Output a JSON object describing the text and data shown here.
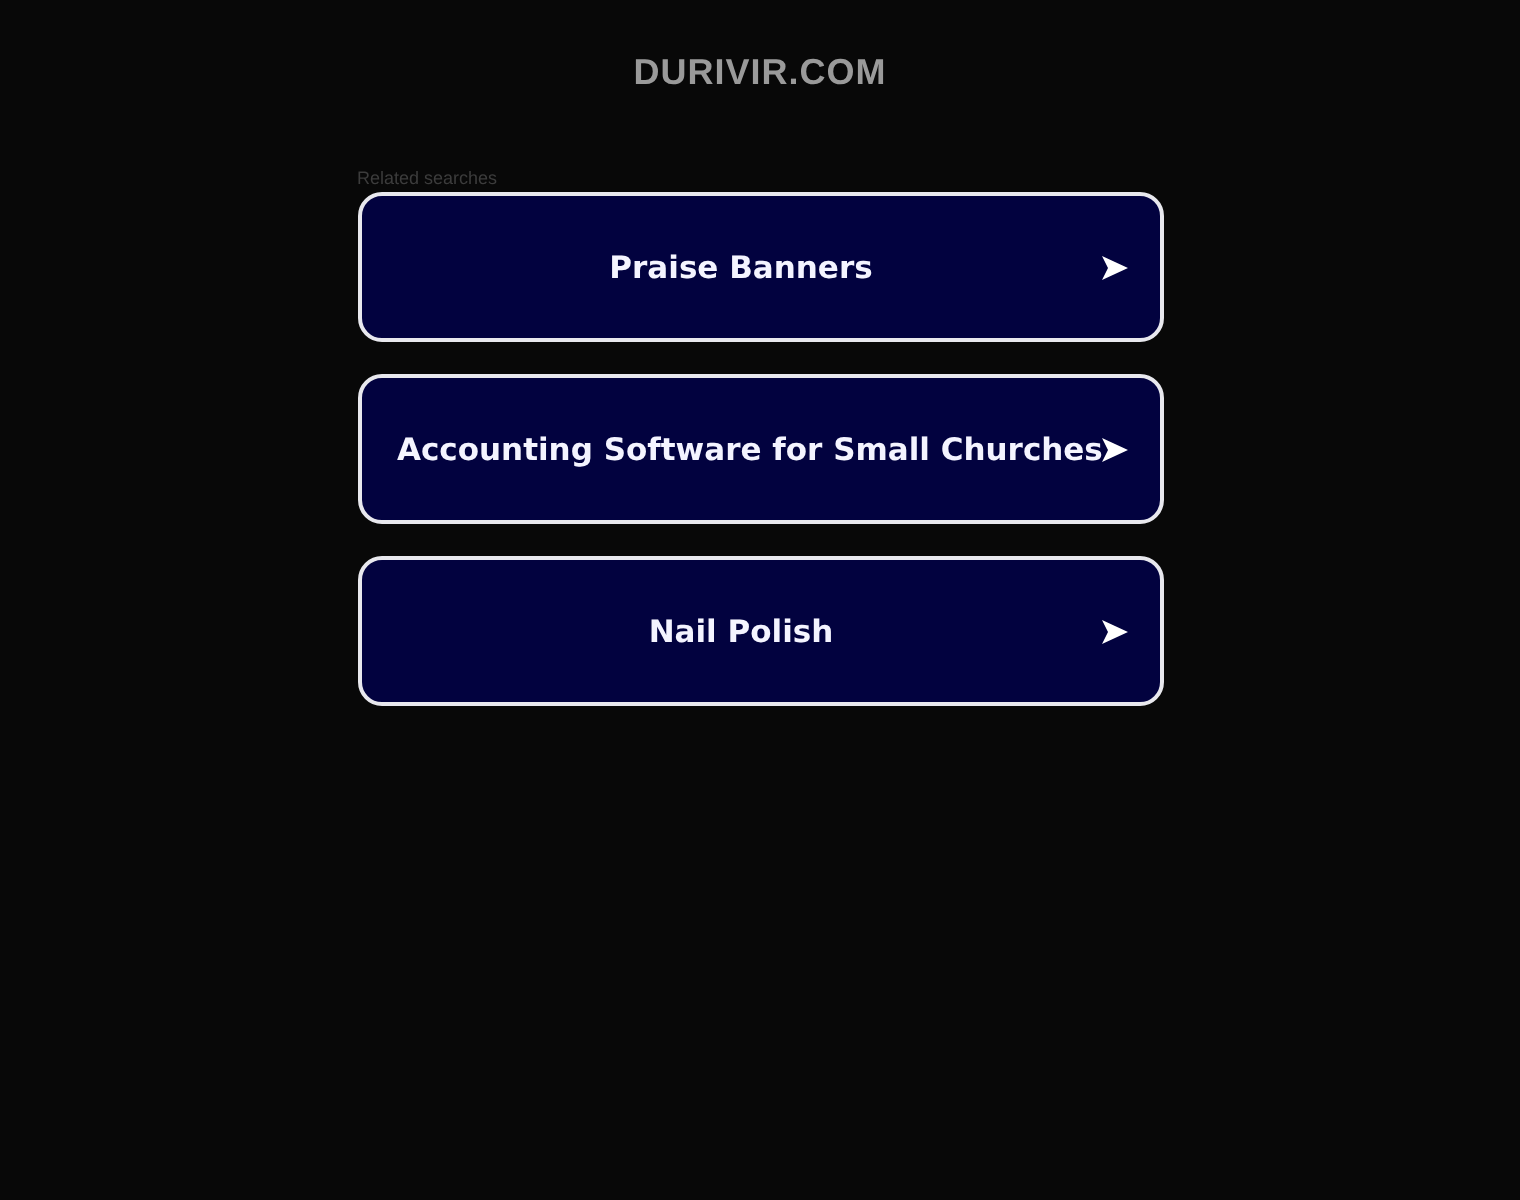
{
  "site_title": "DURIVIR.COM",
  "related_heading": "Related searches",
  "links": [
    {
      "label": "Praise Banners"
    },
    {
      "label": "Accounting Software for Small Churches"
    },
    {
      "label": "Nail Polish"
    }
  ]
}
